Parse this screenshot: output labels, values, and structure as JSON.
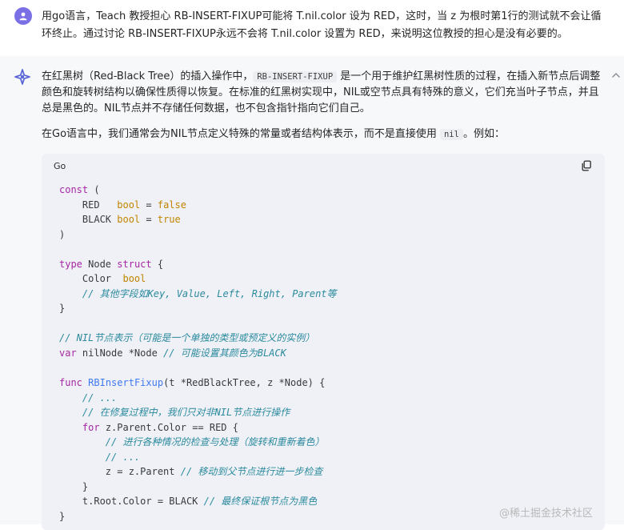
{
  "user_message": {
    "text": "用go语言，Teach 教授担心 RB-INSERT-FIXUP可能将 T.nil.color 设为 RED，这时，当 z 为根时第1行的测试就不会让循环终止。通过讨论 RB-INSERT-FIXUP永远不会将 T.nil.color 设置为 RED，来说明这位教授的担心是没有必要的。"
  },
  "assistant_message": {
    "p1_a": "在红黑树（Red-Black Tree）的插入操作中，",
    "p1_code": "RB-INSERT-FIXUP",
    "p1_b": " 是一个用于维护红黑树性质的过程，在插入新节点后调整颜色和旋转树结构以确保性质得以恢复。在标准的红黑树实现中，NIL或空节点具有特殊的意义，它们充当叶子节点，并且总是黑色的。NIL节点并不存储任何数据，也不包含指针指向它们自己。",
    "p2_a": "在Go语言中，我们通常会为NIL节点定义特殊的常量或者结构体表示，而不是直接使用 ",
    "p2_code": "nil",
    "p2_b": "。例如："
  },
  "code_block": {
    "language": "Go",
    "l1_kw": "const",
    "l1_rest": " (",
    "l2_name": "    RED   ",
    "l2_type": "bool",
    "l2_eq": " = ",
    "l2_val": "false",
    "l3_name": "    BLACK ",
    "l3_type": "bool",
    "l3_eq": " = ",
    "l3_val": "true",
    "l4": ")",
    "l6_kw": "type",
    "l6_name": " Node ",
    "l6_kw2": "struct",
    "l6_rest": " {",
    "l7_name": "    Color  ",
    "l7_type": "bool",
    "l8_cm": "    // 其他字段如Key, Value, Left, Right, Parent等",
    "l9": "}",
    "l11_cm": "// NIL节点表示（可能是一个单独的类型或预定义的实例）",
    "l12_kw": "var",
    "l12_rest": " nilNode *Node ",
    "l12_cm": "// 可能设置其颜色为BLACK",
    "l14_kw": "func",
    "l14_sp": " ",
    "l14_fn": "RBInsertFixup",
    "l14_rest": "(t *RedBlackTree, z *Node) {",
    "l15_cm": "    // ...",
    "l16_cm": "    // 在修复过程中，我们只对非NIL节点进行操作",
    "l17_ind": "    ",
    "l17_kw": "for",
    "l17_rest": " z.Parent.Color == RED {",
    "l18_cm": "        // 进行各种情况的检查与处理（旋转和重新着色）",
    "l19_cm": "        // ...",
    "l20_rest": "        z = z.Parent ",
    "l20_cm": "// 移动到父节点进行进一步检查",
    "l21": "    }",
    "l22_rest": "    t.Root.Color = BLACK ",
    "l22_cm": "// 最终保证根节点为黑色",
    "l23": "}"
  },
  "watermark": "@稀土掘金技术社区",
  "colors": {
    "user_avatar": "#7b6fe6",
    "assistant_bg": "#f7f8fa",
    "code_bg": "#eff1f6",
    "keyword": "#a626a4",
    "bool": "#c18401",
    "function": "#4078f2",
    "comment": "#2b8a9e"
  },
  "icons": {
    "user_avatar": "user-icon",
    "assistant_avatar": "sparkle-logo-icon",
    "collapse": "chevron-up-icon",
    "copy": "copy-icon"
  }
}
